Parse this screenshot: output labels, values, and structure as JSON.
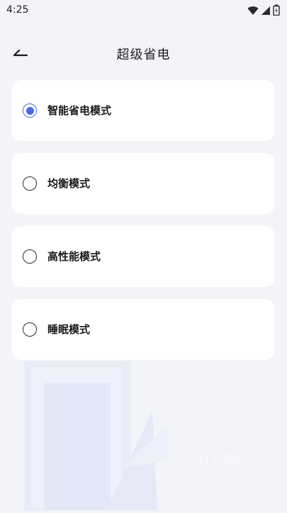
{
  "status_bar": {
    "time": "4:25",
    "icons": [
      "wifi-icon",
      "signal-icon",
      "battery-icon"
    ]
  },
  "header": {
    "back_icon": "back-arrow-icon",
    "title": "超级省电"
  },
  "modes": [
    {
      "label": "智能省电模式",
      "selected": true
    },
    {
      "label": "均衡模式",
      "selected": false
    },
    {
      "label": "高性能模式",
      "selected": false
    },
    {
      "label": "睡眠模式",
      "selected": false
    }
  ],
  "watermark": "221安卓网",
  "colors": {
    "background": "#f3f4f8",
    "card": "#ffffff",
    "accent": "#4a69e8"
  }
}
